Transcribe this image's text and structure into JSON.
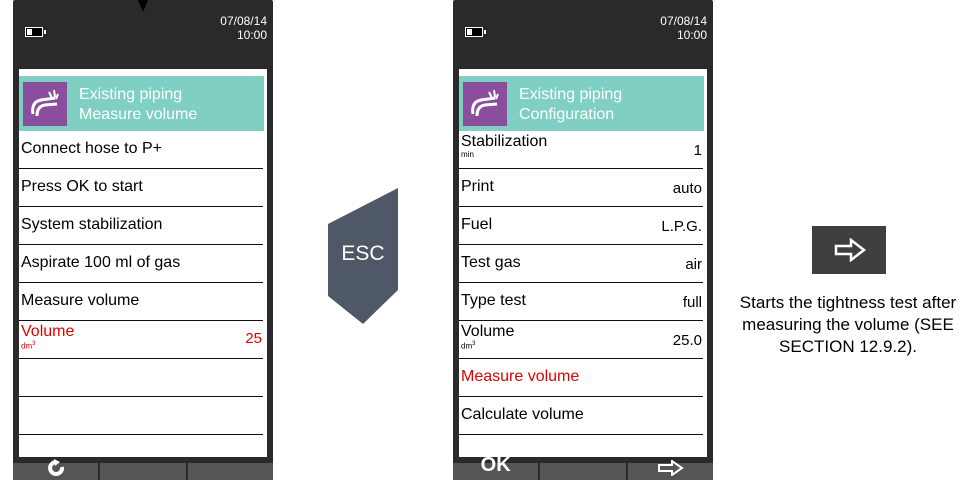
{
  "left_device": {
    "date": "07/08/14",
    "time": "10:00",
    "title_line1": "Existing piping",
    "title_line2": "Measure volume",
    "rows": [
      {
        "label": "Connect hose to P+"
      },
      {
        "label": "Press OK to start"
      },
      {
        "label": "System stabilization"
      },
      {
        "label": "Aspirate 100 ml of gas"
      },
      {
        "label": "Measure volume"
      },
      {
        "label": "Volume",
        "unit": "dm",
        "unit_sup": "3",
        "value": "25"
      }
    ],
    "softkeys": [
      "",
      "",
      ""
    ],
    "softkey_icons": [
      "refresh-icon",
      "",
      ""
    ]
  },
  "right_device": {
    "date": "07/08/14",
    "time": "10:00",
    "title_line1": "Existing piping",
    "title_line2": "Configuration",
    "rows": [
      {
        "label": "Stabilization",
        "unit": "min",
        "value": "1"
      },
      {
        "label": "Print",
        "value": "auto"
      },
      {
        "label": "Fuel",
        "value": "L.P.G."
      },
      {
        "label": "Test gas",
        "value": "air"
      },
      {
        "label": "Type test",
        "value": "full"
      },
      {
        "label": "Volume",
        "unit": "dm",
        "unit_sup": "3",
        "value": "25.0"
      },
      {
        "label": "Measure volume"
      },
      {
        "label": "Calculate volume"
      }
    ],
    "softkeys": [
      "OK",
      "",
      ""
    ],
    "softkey_icons": [
      "",
      "",
      "right-arrow-icon"
    ]
  },
  "esc_key": {
    "label": "ESC"
  },
  "forward_key": {
    "icon": "right-arrow-icon"
  },
  "description": "Starts the tightness test after measuring the volume (SEE SECTION 12.9.2).",
  "colors": {
    "device_body": "#2a2a2a",
    "title_bg": "#7fd0c2",
    "icon_bg": "#8a4e9c",
    "highlight_red": "#e00000",
    "esc_key": "#4f5866"
  }
}
